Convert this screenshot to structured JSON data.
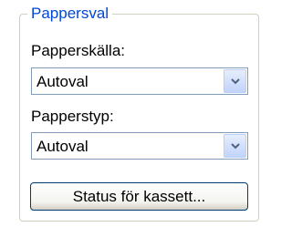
{
  "group": {
    "title": "Pappersval"
  },
  "paper_source": {
    "label": "Papperskälla:",
    "value": "Autoval"
  },
  "paper_type": {
    "label": "Papperstyp:",
    "value": "Autoval"
  },
  "cassette_button": {
    "label": "Status för kassett..."
  },
  "icons": {
    "dropdown": "chevron-down-icon"
  },
  "colors": {
    "legend": "#0046d5",
    "field_border": "#7f9db9",
    "button_border": "#003c74"
  }
}
